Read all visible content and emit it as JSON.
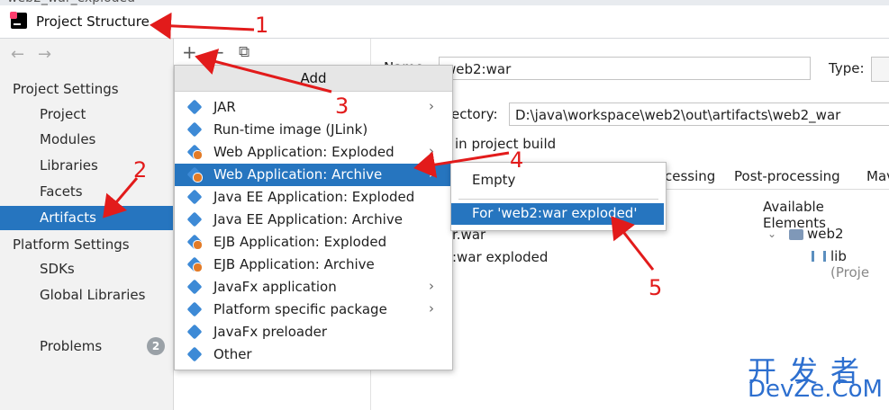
{
  "background_title": "web2_war_exploded",
  "window": {
    "title": "Project Structure"
  },
  "sidebar": {
    "back": "←",
    "forward": "→",
    "project_settings_header": "Project Settings",
    "project_settings_items": [
      "Project",
      "Modules",
      "Libraries",
      "Facets",
      "Artifacts"
    ],
    "platform_settings_header": "Platform Settings",
    "platform_settings_items": [
      "SDKs",
      "Global Libraries"
    ],
    "problems_label": "Problems",
    "problems_count": "2"
  },
  "toolbar": {
    "add": "+",
    "remove": "−",
    "copy": "⧉"
  },
  "add_menu": {
    "header": "Add",
    "items": [
      "JAR",
      "Run-time image (JLink)",
      "Web Application: Exploded",
      "Web Application: Archive",
      "Java EE Application: Exploded",
      "Java EE Application: Archive",
      "EJB Application: Exploded",
      "EJB Application: Archive",
      "JavaFx application",
      "Platform specific package",
      "JavaFx preloader",
      "Other"
    ]
  },
  "submenu": {
    "empty": "Empty",
    "for_exploded": "For 'web2:war exploded'"
  },
  "main": {
    "name_label": "Name:",
    "name_value": "web2:war",
    "type_label": "Type:",
    "output_dir_label": "ectory:",
    "output_dir_value": "D:\\java\\workspace\\web2\\out\\artifacts\\web2_war",
    "include_text": "in project build",
    "tab_processing": "cessing",
    "tab_post_processing": "Post-processing",
    "tab_maven": "Mav",
    "available_elements": "Available Elements",
    "tree_item_1": "r.war",
    "tree_item_2": ":war exploded",
    "avail_web2": "web2",
    "avail_lib": "lib",
    "avail_lib_suffix": "(Proje"
  },
  "annotations": [
    "1",
    "2",
    "3",
    "4",
    "5"
  ],
  "watermark": {
    "line1": "开发者",
    "line2": "DevZe.CoM"
  },
  "colors": {
    "selection": "#2675bf",
    "annotation": "#e21b1b",
    "watermark": "#2d6fcf"
  }
}
